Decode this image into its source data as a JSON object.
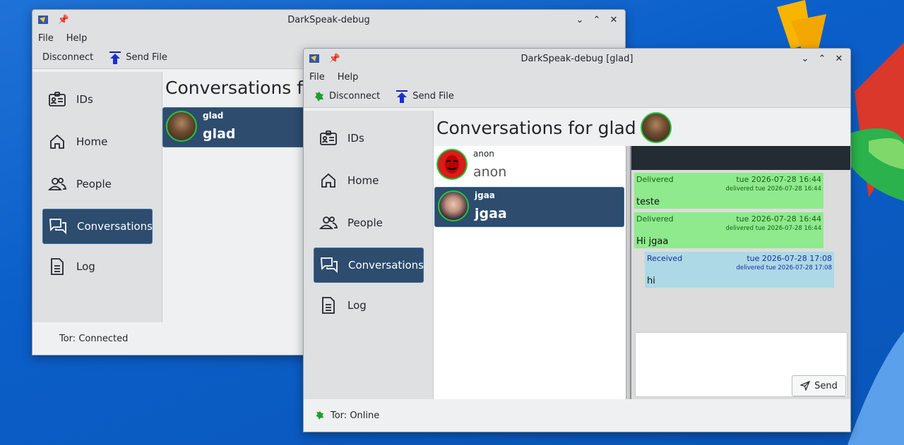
{
  "desktop": {
    "accent_colors": [
      "#f7b500",
      "#e03b2b",
      "#2bb24c",
      "#ffffff"
    ]
  },
  "window_back": {
    "title": "DarkSpeak-debug",
    "menu": [
      "File",
      "Help"
    ],
    "toolbar": {
      "disconnect": "Disconnect",
      "send_file": "Send File"
    },
    "nav": [
      {
        "label": "IDs",
        "icon": "id-card-icon"
      },
      {
        "label": "Home",
        "icon": "home-icon"
      },
      {
        "label": "People",
        "icon": "people-icon"
      },
      {
        "label": "Conversations",
        "icon": "chat-icon",
        "active": true
      },
      {
        "label": "Log",
        "icon": "document-icon"
      }
    ],
    "heading": "Conversations for",
    "conversation": {
      "name_small": "glad",
      "name_large": "glad"
    },
    "status": "Tor: Connected"
  },
  "window_front": {
    "title": "DarkSpeak-debug [glad]",
    "menu": [
      "File",
      "Help"
    ],
    "toolbar": {
      "disconnect": "Disconnect",
      "send_file": "Send File"
    },
    "nav": [
      {
        "label": "IDs",
        "icon": "id-card-icon"
      },
      {
        "label": "Home",
        "icon": "home-icon"
      },
      {
        "label": "People",
        "icon": "people-icon"
      },
      {
        "label": "Conversations",
        "icon": "chat-icon",
        "active": true
      },
      {
        "label": "Log",
        "icon": "document-icon"
      }
    ],
    "heading": "Conversations for glad",
    "conversations": [
      {
        "name_small": "anon",
        "name_large": "anon",
        "selected": false
      },
      {
        "name_small": "jgaa",
        "name_large": "jgaa",
        "selected": true
      }
    ],
    "messages": [
      {
        "status": "Delivered",
        "time": "tue 2026-07-28 16:44",
        "sub": "delivered tue 2026-07-28 16:44",
        "text": "teste",
        "kind": "sent"
      },
      {
        "status": "Delivered",
        "time": "tue 2026-07-28 16:44",
        "sub": "delivered tue 2026-07-28 16:44",
        "text": "Hi jgaa",
        "kind": "sent"
      },
      {
        "status": "Received",
        "time": "tue 2026-07-28 17:08",
        "sub": "delivered tue 2026-07-28 17:08",
        "text": "hi",
        "kind": "received"
      }
    ],
    "compose": {
      "value": "",
      "send_label": "Send"
    },
    "status": "Tor: Online",
    "colors": {
      "sent_bg": "#8eea8c",
      "received_bg": "#add8e6",
      "selected_bg": "#2d4c6e",
      "online": "#1e9e2e"
    }
  }
}
